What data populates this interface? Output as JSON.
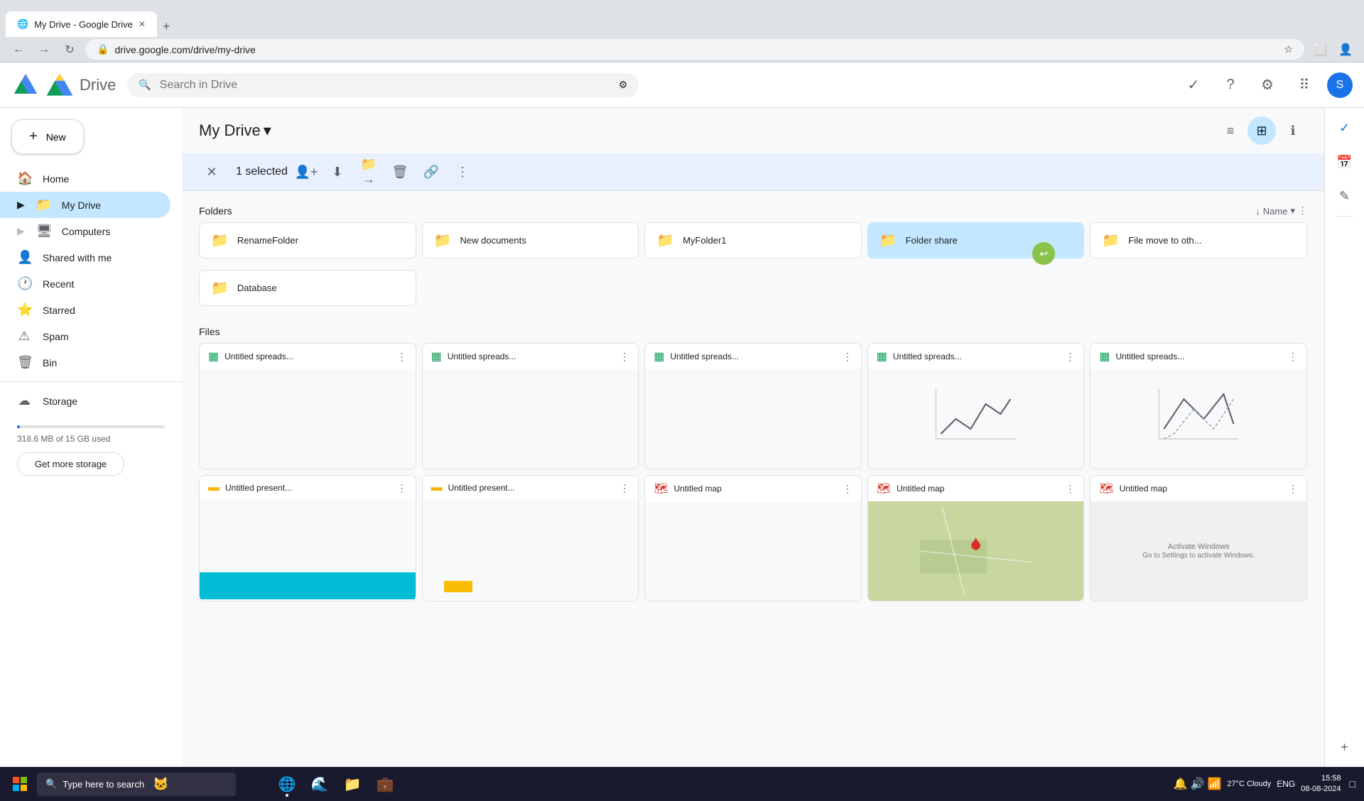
{
  "browser": {
    "tab_title": "My Drive - Google Drive",
    "url": "drive.google.com/drive/my-drive",
    "favicon": "📄"
  },
  "header": {
    "logo_text": "Drive",
    "search_placeholder": "Search in Drive"
  },
  "sidebar": {
    "new_button": "New",
    "nav_items": [
      {
        "id": "home",
        "label": "Home",
        "icon": "🏠",
        "active": false
      },
      {
        "id": "my-drive",
        "label": "My Drive",
        "icon": "📁",
        "active": true
      },
      {
        "id": "computers",
        "label": "Computers",
        "icon": "🖥",
        "active": false
      },
      {
        "id": "shared",
        "label": "Shared with me",
        "icon": "👤",
        "active": false
      },
      {
        "id": "recent",
        "label": "Recent",
        "icon": "🕐",
        "active": false
      },
      {
        "id": "starred",
        "label": "Starred",
        "icon": "⭐",
        "active": false
      },
      {
        "id": "spam",
        "label": "Spam",
        "icon": "⚠",
        "active": false
      },
      {
        "id": "bin",
        "label": "Bin",
        "icon": "🗑",
        "active": false
      },
      {
        "id": "storage",
        "label": "Storage",
        "icon": "☁",
        "active": false
      }
    ],
    "storage_used": "318.6 MB of 15 GB used",
    "storage_percent": 2.1,
    "get_more_storage": "Get more storage"
  },
  "main": {
    "title": "My Drive",
    "selected_text": "1 selected",
    "sections": {
      "folders_title": "Folders",
      "files_title": "Files"
    },
    "sort_label": "Name",
    "folders": [
      {
        "id": "rename-folder",
        "name": "RenameFolder",
        "icon": "folder",
        "selected": false
      },
      {
        "id": "new-documents",
        "name": "New documents",
        "icon": "folder",
        "selected": false
      },
      {
        "id": "myfolder1",
        "name": "MyFolder1",
        "icon": "folder-red",
        "selected": false
      },
      {
        "id": "folder-share",
        "name": "Folder share",
        "icon": "folder",
        "selected": true
      },
      {
        "id": "file-move",
        "name": "File move to oth...",
        "icon": "folder-shared",
        "selected": false
      },
      {
        "id": "database",
        "name": "Database",
        "icon": "folder-shared",
        "selected": false
      }
    ],
    "files": [
      {
        "id": "spreadsheet-1",
        "name": "Untitled spreads...",
        "type": "spreadsheet",
        "preview": "blank"
      },
      {
        "id": "spreadsheet-2",
        "name": "Untitled spreads...",
        "type": "spreadsheet",
        "preview": "blank"
      },
      {
        "id": "spreadsheet-3",
        "name": "Untitled spreads...",
        "type": "spreadsheet",
        "preview": "blank"
      },
      {
        "id": "spreadsheet-4",
        "name": "Untitled spreads...",
        "type": "spreadsheet",
        "preview": "chart1"
      },
      {
        "id": "spreadsheet-5",
        "name": "Untitled spreads...",
        "type": "spreadsheet",
        "preview": "chart2"
      }
    ],
    "presentations": [
      {
        "id": "pres-1",
        "name": "Untitled present...",
        "type": "presentation",
        "preview": "cyan-bar"
      },
      {
        "id": "pres-2",
        "name": "Untitled present...",
        "type": "presentation",
        "preview": "yellow-bar"
      },
      {
        "id": "map-1",
        "name": "Untitled map",
        "type": "map",
        "preview": "blank"
      },
      {
        "id": "map-2",
        "name": "Untitled map",
        "type": "map",
        "preview": "satellite"
      },
      {
        "id": "map-3",
        "name": "Untitled map",
        "type": "map",
        "preview": "windows-activate"
      }
    ]
  },
  "taskbar": {
    "search_placeholder": "Type here to search",
    "time": "15:58",
    "date": "08-08-2024",
    "temperature": "27°C  Cloudy",
    "language": "ENG"
  },
  "right_panel": {
    "icons": [
      "✓",
      "📅",
      "✎",
      "+"
    ]
  }
}
